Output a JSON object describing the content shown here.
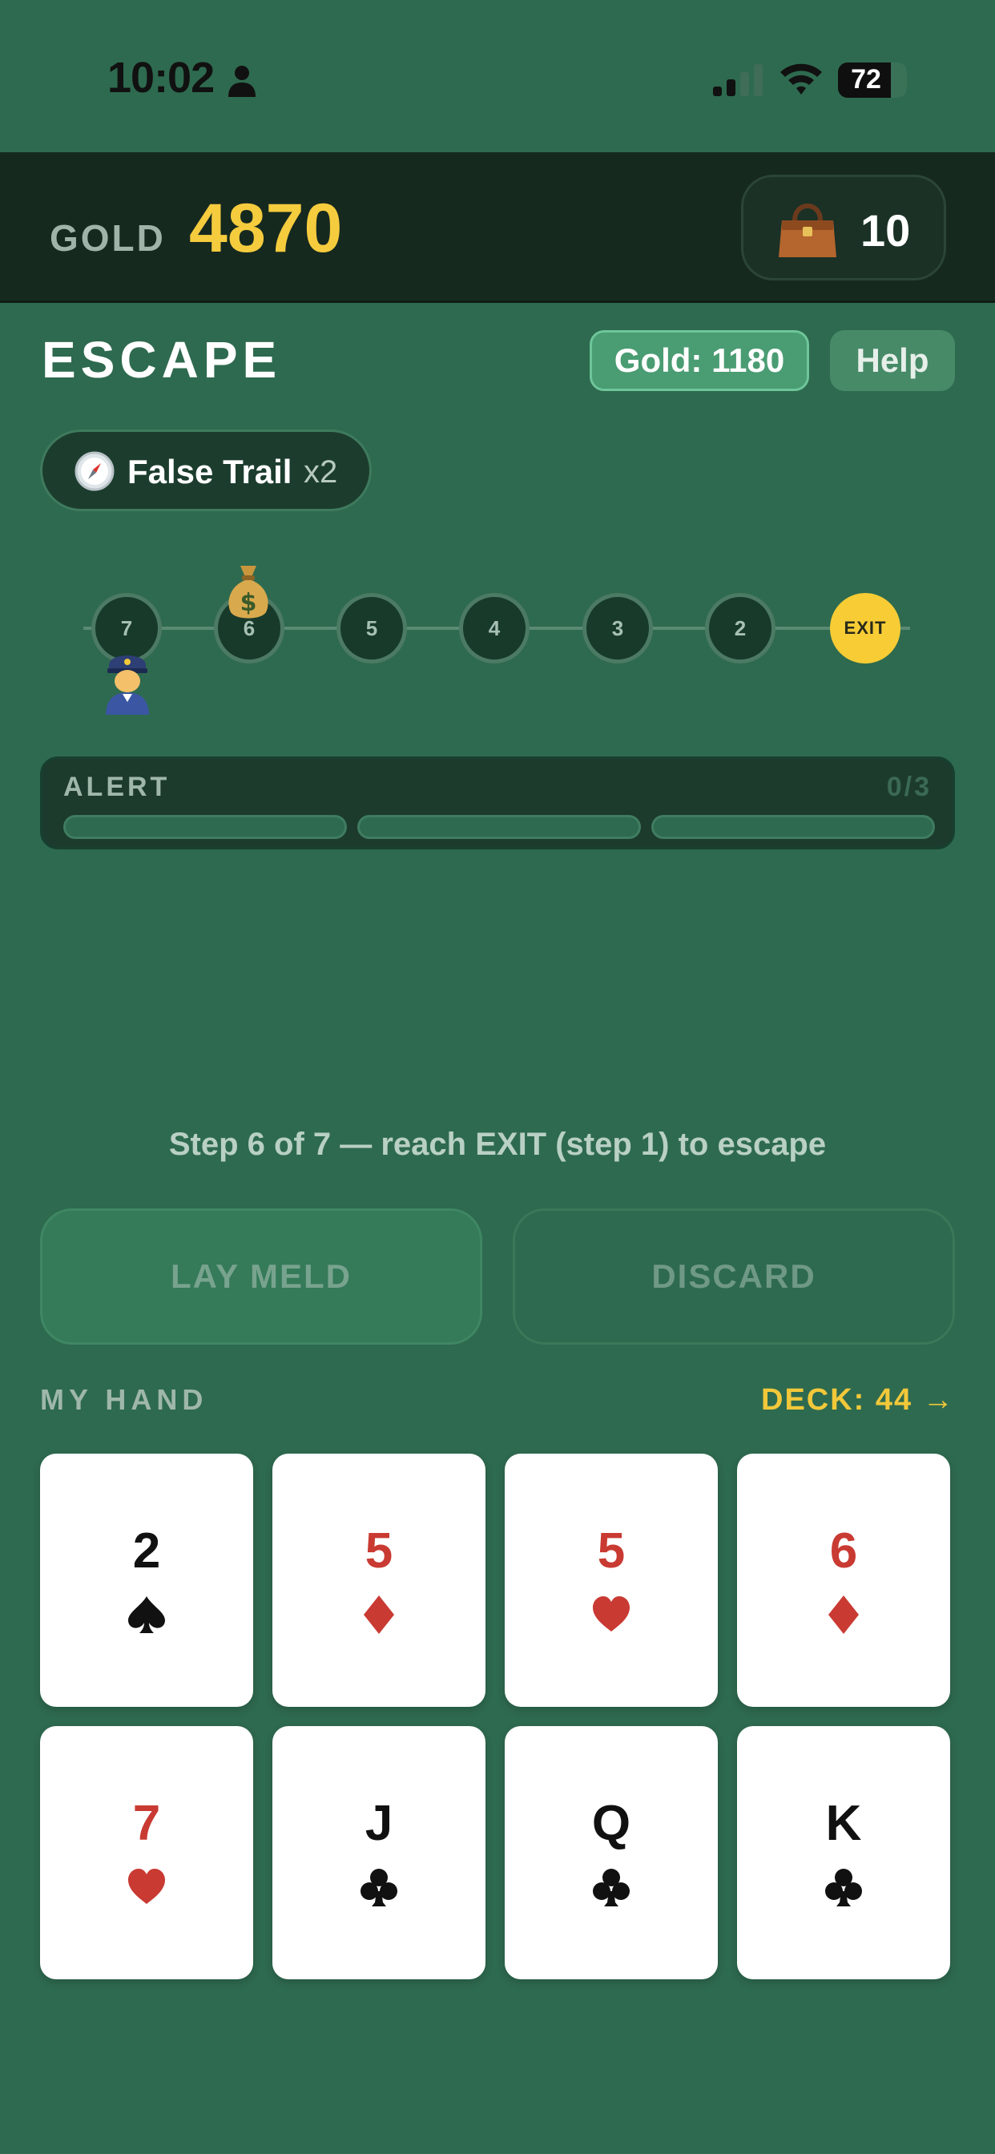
{
  "status_bar": {
    "time": "10:02",
    "battery": "72"
  },
  "header": {
    "gold_label": "GOLD",
    "gold_value": "4870",
    "bag_count": "10"
  },
  "escape": {
    "title": "ESCAPE",
    "gold_pill": "Gold: 1180",
    "help_label": "Help",
    "false_trail_label": "False Trail",
    "false_trail_multiplier": "x2"
  },
  "track": {
    "steps": [
      "7",
      "6",
      "5",
      "4",
      "3",
      "2",
      "EXIT"
    ],
    "current_step": "6",
    "pursuer_step": "7"
  },
  "alert": {
    "label": "ALERT",
    "count": "0/3",
    "level": 0,
    "max": 3
  },
  "step_message": "Step 6 of 7 — reach EXIT (step 1) to escape",
  "actions": {
    "lay_meld": "LAY MELD",
    "discard": "DISCARD"
  },
  "hand": {
    "label": "MY HAND",
    "deck_label": "DECK: 44 →",
    "cards": [
      {
        "rank": "2",
        "suit": "spade",
        "color": "black"
      },
      {
        "rank": "5",
        "suit": "diamond",
        "color": "red"
      },
      {
        "rank": "5",
        "suit": "heart",
        "color": "red"
      },
      {
        "rank": "6",
        "suit": "diamond",
        "color": "red"
      },
      {
        "rank": "7",
        "suit": "heart",
        "color": "red"
      },
      {
        "rank": "J",
        "suit": "club",
        "color": "black"
      },
      {
        "rank": "Q",
        "suit": "club",
        "color": "black"
      },
      {
        "rank": "K",
        "suit": "club",
        "color": "black"
      }
    ]
  },
  "colors": {
    "background": "#2e6a4f",
    "gold": "#f5cc3e",
    "header": "#16291f",
    "red_suit": "#c93a32"
  }
}
